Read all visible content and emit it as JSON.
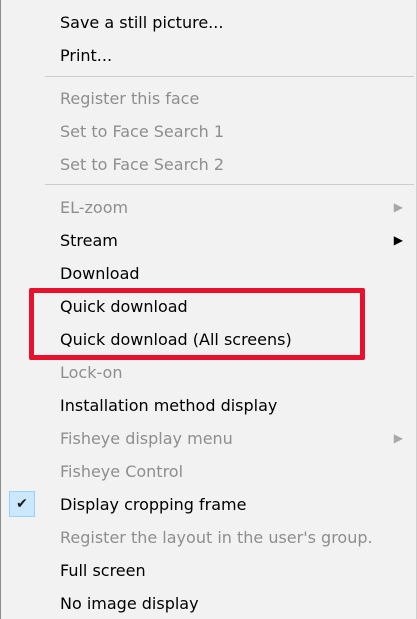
{
  "menu": {
    "items": [
      {
        "label": "Save a still picture...",
        "enabled": true
      },
      {
        "label": "Print...",
        "enabled": true
      },
      {
        "label": "Register this face",
        "enabled": false
      },
      {
        "label": "Set to Face Search 1",
        "enabled": false
      },
      {
        "label": "Set to Face Search 2",
        "enabled": false
      },
      {
        "label": "EL-zoom",
        "enabled": false,
        "submenu_arrow": "▶"
      },
      {
        "label": "Stream",
        "enabled": true,
        "submenu_arrow": "▶"
      },
      {
        "label": "Download",
        "enabled": true
      },
      {
        "label": "Quick download",
        "enabled": true
      },
      {
        "label": "Quick download (All screens)",
        "enabled": true
      },
      {
        "label": "Lock-on",
        "enabled": false
      },
      {
        "label": "Installation method display",
        "enabled": true
      },
      {
        "label": "Fisheye display menu",
        "enabled": false,
        "submenu_arrow": "▶"
      },
      {
        "label": "Fisheye Control",
        "enabled": false
      },
      {
        "label": "Display cropping frame",
        "enabled": true,
        "checked": true,
        "check_glyph": "✔"
      },
      {
        "label": "Register the layout in the user's group.",
        "enabled": false
      },
      {
        "label": "Full screen",
        "enabled": true
      },
      {
        "label": "No image display",
        "enabled": true
      }
    ]
  },
  "annotation": {
    "highlight_color": "#e8102c"
  }
}
